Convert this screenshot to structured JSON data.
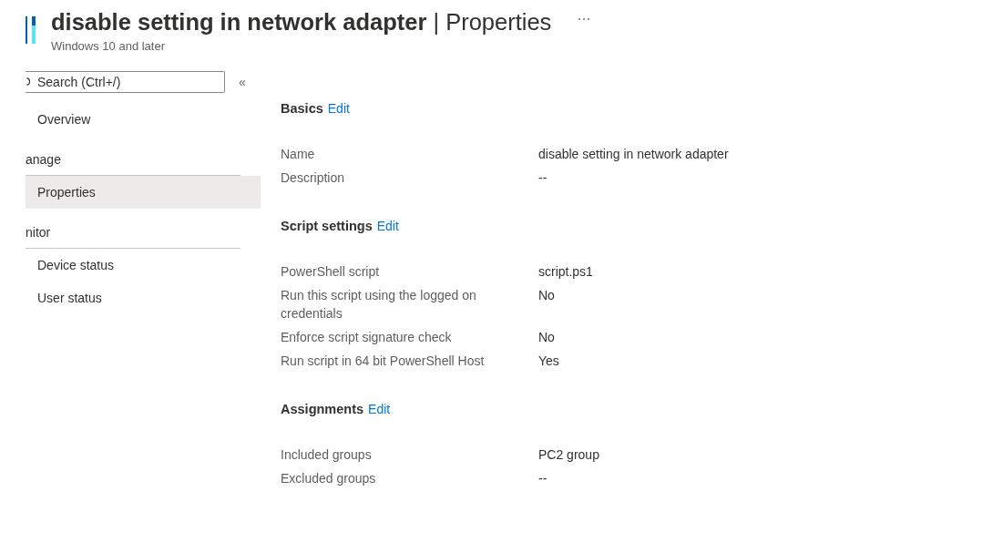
{
  "header": {
    "title": "disable setting in network adapter",
    "separator": "|",
    "section": "Properties",
    "subtitle": "Windows 10 and later"
  },
  "sidebar": {
    "search": {
      "placeholder": "Search (Ctrl+/)"
    },
    "collapse": "«",
    "top_items": [
      {
        "label": "Overview",
        "selected": false
      }
    ],
    "groups": [
      {
        "heading": "anage",
        "items": [
          {
            "label": "Properties",
            "selected": true
          }
        ]
      },
      {
        "heading": "nitor",
        "items": [
          {
            "label": "Device status",
            "selected": false
          },
          {
            "label": "User status",
            "selected": false
          }
        ]
      }
    ]
  },
  "sections": [
    {
      "title": "Basics",
      "action": "Edit",
      "rows": [
        {
          "label": "Name",
          "value": "disable setting in network adapter"
        },
        {
          "label": "Description",
          "value": "--"
        }
      ]
    },
    {
      "title": "Script settings",
      "action": "Edit",
      "rows": [
        {
          "label": "PowerShell script",
          "value": "script.ps1"
        },
        {
          "label": "Run this script using the logged on credentials",
          "value": "No"
        },
        {
          "label": "Enforce script signature check",
          "value": "No"
        },
        {
          "label": "Run script in 64 bit PowerShell Host",
          "value": "Yes"
        }
      ]
    },
    {
      "title": "Assignments",
      "action": "Edit",
      "rows": [
        {
          "label": "Included groups",
          "value": "PC2 group"
        },
        {
          "label": "Excluded groups",
          "value": "--"
        }
      ]
    }
  ]
}
